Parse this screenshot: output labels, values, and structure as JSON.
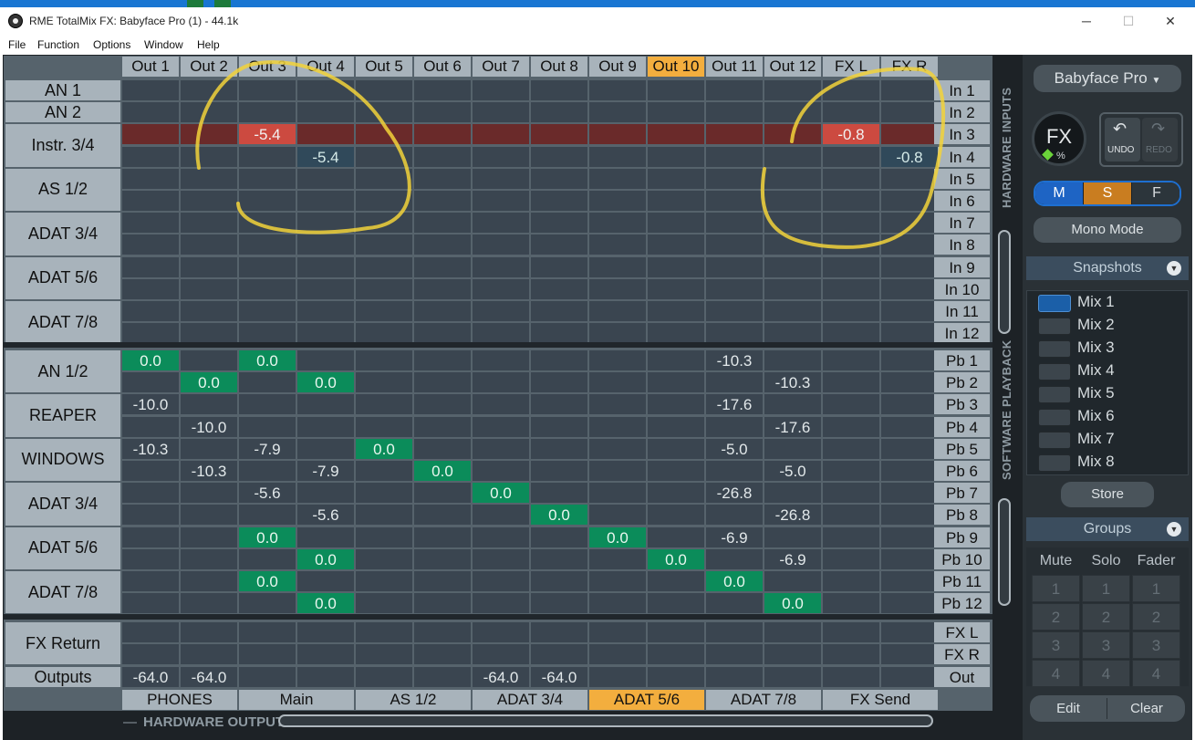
{
  "window": {
    "title": "RME TotalMix FX: Babyface Pro (1) - 44.1k",
    "controls": {
      "minimize": "─",
      "maximize": "☐",
      "close": "✕"
    }
  },
  "menu": [
    "File",
    "Function",
    "Options",
    "Window",
    "Help"
  ],
  "matrix": {
    "columns": [
      "Out 1",
      "Out 2",
      "Out 3",
      "Out 4",
      "Out 5",
      "Out 6",
      "Out 7",
      "Out 8",
      "Out 9",
      "Out 10",
      "Out 11",
      "Out 12",
      "FX L",
      "FX R"
    ],
    "selected_column": "Out 10",
    "hardware_inputs": {
      "section_label": "HARDWARE INPUTS",
      "groups": [
        {
          "label": "AN 1",
          "rows": 1
        },
        {
          "label": "AN 2",
          "rows": 1
        },
        {
          "label": "Instr. 3/4",
          "rows": 2
        },
        {
          "label": "AS 1/2",
          "rows": 2
        },
        {
          "label": "ADAT 3/4",
          "rows": 2
        },
        {
          "label": "ADAT 5/6",
          "rows": 2
        },
        {
          "label": "ADAT 7/8",
          "rows": 2
        }
      ],
      "channels": [
        "In 1",
        "In 2",
        "In 3",
        "In 4",
        "In 5",
        "In 6",
        "In 7",
        "In 8",
        "In 9",
        "In 10",
        "In 11",
        "In 12"
      ],
      "cells": [
        {
          "row": 2,
          "col": 2,
          "value": "-5.4",
          "style": "red"
        },
        {
          "row": 2,
          "col": 12,
          "value": "-0.8",
          "style": "red"
        },
        {
          "row": 3,
          "col": 3,
          "value": "-5.4",
          "style": "teal"
        },
        {
          "row": 3,
          "col": 13,
          "value": "-0.8",
          "style": "teal"
        }
      ],
      "highlighted_row": 2
    },
    "software_playback": {
      "section_label": "SOFTWARE PLAYBACK",
      "groups": [
        {
          "label": "AN 1/2",
          "rows": 2
        },
        {
          "label": "REAPER",
          "rows": 2
        },
        {
          "label": "WINDOWS",
          "rows": 2
        },
        {
          "label": "ADAT 3/4",
          "rows": 2
        },
        {
          "label": "ADAT 5/6",
          "rows": 2
        },
        {
          "label": "ADAT 7/8",
          "rows": 2
        }
      ],
      "channels": [
        "Pb 1",
        "Pb 2",
        "Pb 3",
        "Pb 4",
        "Pb 5",
        "Pb 6",
        "Pb 7",
        "Pb 8",
        "Pb 9",
        "Pb 10",
        "Pb 11",
        "Pb 12"
      ],
      "cells": [
        {
          "row": 0,
          "col": 0,
          "value": "0.0",
          "style": "green"
        },
        {
          "row": 0,
          "col": 2,
          "value": "0.0",
          "style": "green"
        },
        {
          "row": 0,
          "col": 10,
          "value": "-10.3",
          "style": ""
        },
        {
          "row": 1,
          "col": 1,
          "value": "0.0",
          "style": "green"
        },
        {
          "row": 1,
          "col": 3,
          "value": "0.0",
          "style": "green"
        },
        {
          "row": 1,
          "col": 11,
          "value": "-10.3",
          "style": ""
        },
        {
          "row": 2,
          "col": 0,
          "value": "-10.0",
          "style": ""
        },
        {
          "row": 2,
          "col": 10,
          "value": "-17.6",
          "style": ""
        },
        {
          "row": 3,
          "col": 1,
          "value": "-10.0",
          "style": ""
        },
        {
          "row": 3,
          "col": 11,
          "value": "-17.6",
          "style": ""
        },
        {
          "row": 4,
          "col": 0,
          "value": "-10.3",
          "style": ""
        },
        {
          "row": 4,
          "col": 2,
          "value": "-7.9",
          "style": ""
        },
        {
          "row": 4,
          "col": 4,
          "value": "0.0",
          "style": "green"
        },
        {
          "row": 4,
          "col": 10,
          "value": "-5.0",
          "style": ""
        },
        {
          "row": 5,
          "col": 1,
          "value": "-10.3",
          "style": ""
        },
        {
          "row": 5,
          "col": 3,
          "value": "-7.9",
          "style": ""
        },
        {
          "row": 5,
          "col": 5,
          "value": "0.0",
          "style": "green"
        },
        {
          "row": 5,
          "col": 11,
          "value": "-5.0",
          "style": ""
        },
        {
          "row": 6,
          "col": 2,
          "value": "-5.6",
          "style": ""
        },
        {
          "row": 6,
          "col": 6,
          "value": "0.0",
          "style": "green"
        },
        {
          "row": 6,
          "col": 10,
          "value": "-26.8",
          "style": ""
        },
        {
          "row": 7,
          "col": 3,
          "value": "-5.6",
          "style": ""
        },
        {
          "row": 7,
          "col": 7,
          "value": "0.0",
          "style": "green"
        },
        {
          "row": 7,
          "col": 11,
          "value": "-26.8",
          "style": ""
        },
        {
          "row": 8,
          "col": 2,
          "value": "0.0",
          "style": "green"
        },
        {
          "row": 8,
          "col": 8,
          "value": "0.0",
          "style": "green"
        },
        {
          "row": 8,
          "col": 10,
          "value": "-6.9",
          "style": ""
        },
        {
          "row": 9,
          "col": 3,
          "value": "0.0",
          "style": "green"
        },
        {
          "row": 9,
          "col": 9,
          "value": "0.0",
          "style": "green"
        },
        {
          "row": 9,
          "col": 11,
          "value": "-6.9",
          "style": ""
        },
        {
          "row": 10,
          "col": 2,
          "value": "0.0",
          "style": "green"
        },
        {
          "row": 10,
          "col": 10,
          "value": "0.0",
          "style": "green"
        },
        {
          "row": 11,
          "col": 3,
          "value": "0.0",
          "style": "green"
        },
        {
          "row": 11,
          "col": 11,
          "value": "0.0",
          "style": "green"
        }
      ]
    },
    "fx_return": {
      "label": "FX Return",
      "channels": [
        "FX L",
        "FX R"
      ]
    },
    "outputs": {
      "label": "Outputs",
      "channel": "Out",
      "cells": [
        {
          "col": 0,
          "value": "-64.0"
        },
        {
          "col": 1,
          "value": "-64.0"
        },
        {
          "col": 6,
          "value": "-64.0"
        },
        {
          "col": 7,
          "value": "-64.0"
        }
      ]
    },
    "output_groups": [
      "PHONES",
      "Main",
      "AS 1/2",
      "ADAT 3/4",
      "ADAT 5/6",
      "ADAT 7/8",
      "FX Send"
    ],
    "selected_output_group": "ADAT 5/6",
    "hardware_outputs_label": "HARDWARE OUTPUTS",
    "hardware_outputs_prefix": "—"
  },
  "panel": {
    "device": "Babyface Pro",
    "fx_label": "FX",
    "fx_unit": "%",
    "undo": "UNDO",
    "redo": "REDO",
    "msf": [
      "M",
      "S",
      "F"
    ],
    "mono_mode": "Mono Mode",
    "snapshots_title": "Snapshots",
    "mixes": [
      "Mix 1",
      "Mix 2",
      "Mix 3",
      "Mix 4",
      "Mix 5",
      "Mix 6",
      "Mix 7",
      "Mix 8"
    ],
    "active_mix": "Mix 1",
    "store": "Store",
    "groups_title": "Groups",
    "group_headers": [
      "Mute",
      "Solo",
      "Fader"
    ],
    "group_rows": [
      [
        "1",
        "1",
        "1"
      ],
      [
        "2",
        "2",
        "2"
      ],
      [
        "3",
        "3",
        "3"
      ],
      [
        "4",
        "4",
        "4"
      ]
    ],
    "edit": "Edit",
    "clear": "Clear"
  },
  "colors": {
    "selected": "#f3ae3e",
    "green_cell": "#0b8c5a",
    "red_cell": "#cc4a40",
    "red_row": "#6a2a2a",
    "annotation": "#f2d23a"
  }
}
